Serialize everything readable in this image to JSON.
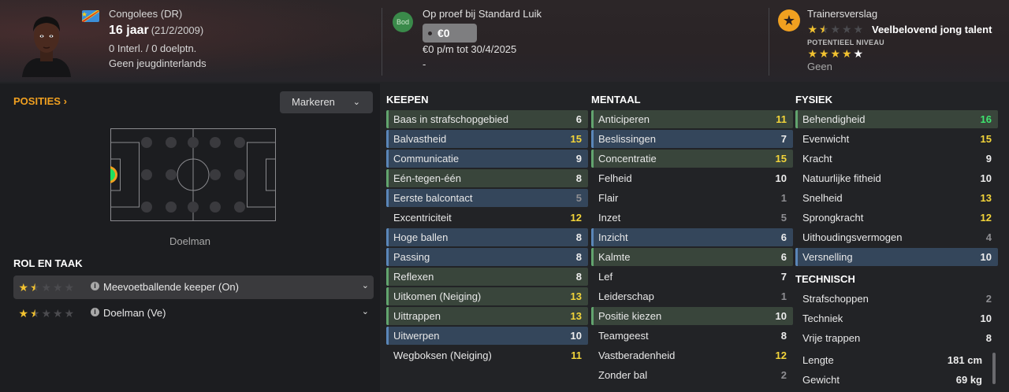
{
  "header": {
    "nationality": "Congolees (DR)",
    "age": "16 jaar",
    "birthdate": "(21/2/2009)",
    "internationals": "0 Interl. / 0 doelptn.",
    "youth_caps": "Geen jeugdinterlands",
    "bid_badge": "Bod",
    "trial_text": "Op proef bij Standard Luik",
    "price": "€0",
    "wage_text": "€0 p/m tot 30/4/2025",
    "dash": "-",
    "report_title": "Trainersverslag",
    "report_text": "Veelbelovend jong talent",
    "report_stars": [
      1,
      0.5,
      0,
      0,
      0
    ],
    "potential_label": "POTENTIEEL NIVEAU",
    "potential_stars": [
      1,
      1,
      1,
      1,
      1
    ],
    "potential_text": "Geen"
  },
  "left": {
    "posities_label": "POSITIES",
    "markeren_label": "Markeren",
    "position_label": "Doelman",
    "rol_title": "ROL EN TAAK",
    "roles": [
      {
        "name": "Meevoetballende keeper (On)",
        "stars": [
          1,
          0.5,
          0,
          0,
          0
        ],
        "active": true
      },
      {
        "name": "Doelman (Ve)",
        "stars": [
          1,
          0.5,
          0,
          0,
          0
        ],
        "active": false
      }
    ]
  },
  "colors": {
    "accent_orange": "#f0a020",
    "value_yellow": "#f2d43a",
    "value_green": "#3ee46e",
    "row_green": "#39453b",
    "row_blue": "#34465b"
  },
  "columns": {
    "keepen": {
      "title": "KEEPEN",
      "rows": [
        {
          "label": "Baas in strafschopgebied",
          "value": "6",
          "hl": "green",
          "tone": "white"
        },
        {
          "label": "Balvastheid",
          "value": "15",
          "hl": "blue",
          "tone": "yellow"
        },
        {
          "label": "Communicatie",
          "value": "9",
          "hl": "blue",
          "tone": "white"
        },
        {
          "label": "Eén-tegen-één",
          "value": "8",
          "hl": "green",
          "tone": "white"
        },
        {
          "label": "Eerste balcontact",
          "value": "5",
          "hl": "blue",
          "tone": "grey"
        },
        {
          "label": "Excentriciteit",
          "value": "12",
          "hl": "none",
          "tone": "yellow"
        },
        {
          "label": "Hoge ballen",
          "value": "8",
          "hl": "blue",
          "tone": "white"
        },
        {
          "label": "Passing",
          "value": "8",
          "hl": "blue",
          "tone": "white"
        },
        {
          "label": "Reflexen",
          "value": "8",
          "hl": "green",
          "tone": "white"
        },
        {
          "label": "Uitkomen (Neiging)",
          "value": "13",
          "hl": "green",
          "tone": "yellow"
        },
        {
          "label": "Uittrappen",
          "value": "13",
          "hl": "green",
          "tone": "yellow"
        },
        {
          "label": "Uitwerpen",
          "value": "10",
          "hl": "blue",
          "tone": "white"
        },
        {
          "label": "Wegboksen (Neiging)",
          "value": "11",
          "hl": "none",
          "tone": "yellow"
        }
      ]
    },
    "mentaal": {
      "title": "MENTAAL",
      "rows": [
        {
          "label": "Anticiperen",
          "value": "11",
          "hl": "green",
          "tone": "yellow"
        },
        {
          "label": "Beslissingen",
          "value": "7",
          "hl": "blue",
          "tone": "white"
        },
        {
          "label": "Concentratie",
          "value": "15",
          "hl": "green",
          "tone": "yellow"
        },
        {
          "label": "Felheid",
          "value": "10",
          "hl": "none",
          "tone": "white"
        },
        {
          "label": "Flair",
          "value": "1",
          "hl": "none",
          "tone": "grey"
        },
        {
          "label": "Inzet",
          "value": "5",
          "hl": "none",
          "tone": "grey"
        },
        {
          "label": "Inzicht",
          "value": "6",
          "hl": "blue",
          "tone": "white"
        },
        {
          "label": "Kalmte",
          "value": "6",
          "hl": "green",
          "tone": "white"
        },
        {
          "label": "Lef",
          "value": "7",
          "hl": "none",
          "tone": "white"
        },
        {
          "label": "Leiderschap",
          "value": "1",
          "hl": "none",
          "tone": "grey"
        },
        {
          "label": "Positie kiezen",
          "value": "10",
          "hl": "green",
          "tone": "white"
        },
        {
          "label": "Teamgeest",
          "value": "8",
          "hl": "none",
          "tone": "white"
        },
        {
          "label": "Vastberadenheid",
          "value": "12",
          "hl": "none",
          "tone": "yellow"
        },
        {
          "label": "Zonder bal",
          "value": "2",
          "hl": "none",
          "tone": "grey"
        }
      ]
    },
    "fysiek": {
      "title": "FYSIEK",
      "rows": [
        {
          "label": "Behendigheid",
          "value": "16",
          "hl": "green",
          "tone": "green"
        },
        {
          "label": "Evenwicht",
          "value": "15",
          "hl": "none",
          "tone": "yellow"
        },
        {
          "label": "Kracht",
          "value": "9",
          "hl": "none",
          "tone": "white"
        },
        {
          "label": "Natuurlijke fitheid",
          "value": "10",
          "hl": "none",
          "tone": "white"
        },
        {
          "label": "Snelheid",
          "value": "13",
          "hl": "none",
          "tone": "yellow"
        },
        {
          "label": "Sprongkracht",
          "value": "12",
          "hl": "none",
          "tone": "yellow"
        },
        {
          "label": "Uithoudingsvermogen",
          "value": "4",
          "hl": "none",
          "tone": "grey"
        },
        {
          "label": "Versnelling",
          "value": "10",
          "hl": "blue",
          "tone": "white"
        }
      ]
    },
    "technisch": {
      "title": "TECHNISCH",
      "rows": [
        {
          "label": "Strafschoppen",
          "value": "2",
          "hl": "none",
          "tone": "grey"
        },
        {
          "label": "Techniek",
          "value": "10",
          "hl": "none",
          "tone": "white"
        },
        {
          "label": "Vrije trappen",
          "value": "8",
          "hl": "none",
          "tone": "white"
        }
      ]
    },
    "info": {
      "rows": [
        {
          "label": "Lengte",
          "value": "181 cm",
          "hl": "none",
          "tone": "white"
        },
        {
          "label": "Gewicht",
          "value": "69 kg",
          "hl": "none",
          "tone": "white"
        }
      ]
    }
  }
}
